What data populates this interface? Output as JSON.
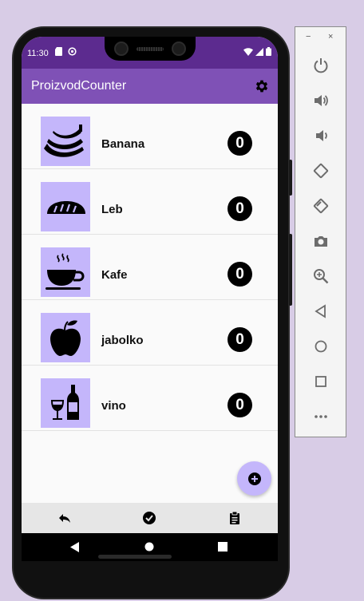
{
  "status_bar": {
    "time": "11:30"
  },
  "app_bar": {
    "title": "ProizvodCounter",
    "settings_icon": "gear-icon"
  },
  "products": [
    {
      "name": "Banana",
      "count": "0",
      "icon": "banana-icon"
    },
    {
      "name": "Leb",
      "count": "0",
      "icon": "bread-icon"
    },
    {
      "name": "Kafe",
      "count": "0",
      "icon": "coffee-icon"
    },
    {
      "name": "jabolko",
      "count": "0",
      "icon": "apple-icon"
    },
    {
      "name": "vino",
      "count": "0",
      "icon": "wine-icon"
    }
  ],
  "fab": {
    "icon": "add-circle-icon"
  },
  "bottom_bar": {
    "items": [
      "undo-icon",
      "check-circle-icon",
      "clipboard-icon"
    ]
  },
  "emulator_panel": {
    "minimize": "−",
    "close": "×",
    "tools": [
      "power-icon",
      "volume-up-icon",
      "volume-down-icon",
      "rotate-left-icon",
      "rotate-right-icon",
      "camera-icon",
      "zoom-icon",
      "back-icon",
      "home-icon",
      "overview-icon",
      "more-icon"
    ]
  },
  "colors": {
    "status_bar": "#5c2b8f",
    "app_bar": "#7f51b6",
    "thumb_bg": "#c4b6fb",
    "fab": "#c4b6fb",
    "background": "#d8cce6"
  }
}
